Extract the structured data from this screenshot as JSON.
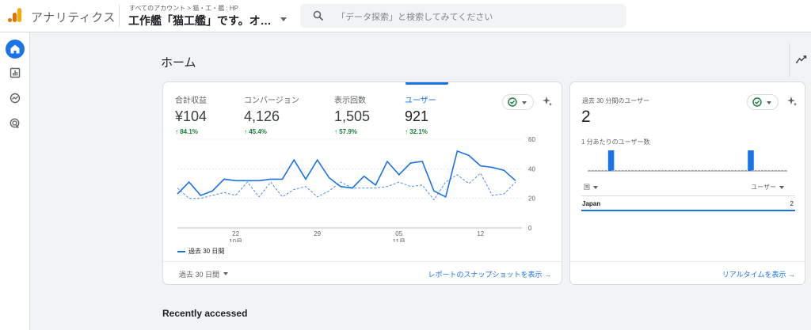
{
  "header": {
    "app_name": "アナリティクス",
    "breadcrumb": "すべてのアカウント > 猫・工・艦 : HP",
    "property": "工作艦「猫工艦」です。オ…",
    "search_placeholder": "「データ探索」と検索してみてください"
  },
  "leftnav": {
    "items": [
      {
        "name": "home",
        "icon": "home-icon",
        "active": true
      },
      {
        "name": "reports",
        "icon": "bar-chart-icon",
        "active": false
      },
      {
        "name": "explore",
        "icon": "explore-icon",
        "active": false
      },
      {
        "name": "advertising",
        "icon": "target-icon",
        "active": false
      }
    ]
  },
  "page": {
    "title": "ホーム",
    "recent_heading": "Recently accessed"
  },
  "overview": {
    "metrics": [
      {
        "label": "合計収益",
        "value": "¥104",
        "change": "84.1%",
        "selected": false
      },
      {
        "label": "コンバージョン",
        "value": "4,126",
        "change": "45.4%",
        "selected": false
      },
      {
        "label": "表示回数",
        "value": "1,505",
        "change": "57.9%",
        "selected": false
      },
      {
        "label": "ユーザー",
        "value": "921",
        "change": "32.1%",
        "selected": true
      }
    ],
    "legend": "過去 30 日間",
    "period_selector": "過去 30 日間",
    "snapshot_link": "レポートのスナップショットを表示 →"
  },
  "chart_data": {
    "type": "line",
    "x_tick_labels": [
      {
        "day": "22",
        "month": "10月"
      },
      {
        "day": "29",
        "month": ""
      },
      {
        "day": "05",
        "month": "11月"
      },
      {
        "day": "12",
        "month": ""
      }
    ],
    "y_ticks": [
      0,
      20,
      40,
      60
    ],
    "ylim": [
      0,
      60
    ],
    "series": [
      {
        "name": "過去 30 日間",
        "style": "solid",
        "color": "#1a73e8",
        "values": [
          23,
          31,
          22,
          25,
          33,
          32,
          32,
          32,
          33,
          33,
          46,
          33,
          46,
          34,
          28,
          27,
          35,
          29,
          45,
          36,
          44,
          45,
          25,
          21,
          52,
          49,
          42,
          41,
          39,
          32
        ]
      },
      {
        "name": "",
        "style": "dashed",
        "color": "#4a8ff0",
        "values": [
          27,
          20,
          20,
          22,
          24,
          22,
          31,
          21,
          31,
          21,
          26,
          28,
          21,
          25,
          31,
          27,
          27,
          27,
          28,
          31,
          28,
          29,
          19,
          31,
          36,
          30,
          37,
          22,
          23,
          31
        ]
      }
    ]
  },
  "realtime": {
    "title": "過去 30 分間のユーザー",
    "value": "2",
    "subtitle": "1 分あたりのユーザー数",
    "per_minute": [
      0,
      0,
      0,
      0,
      0,
      0,
      1,
      0,
      0,
      0,
      0,
      0,
      0,
      0,
      0,
      0,
      0,
      0,
      0,
      0,
      0,
      0,
      0,
      0,
      0,
      0,
      0,
      0,
      0,
      0,
      0,
      0,
      0,
      0,
      0,
      0,
      0,
      0,
      0,
      0,
      0,
      0,
      0,
      0,
      0,
      0,
      0,
      0,
      1,
      0,
      0,
      0,
      0,
      0,
      0,
      0,
      0,
      0,
      0,
      0
    ],
    "col_country": "国",
    "col_users": "ユーザー",
    "rows": [
      {
        "country": "Japan",
        "users": "2"
      }
    ],
    "link": "リアルタイムを表示 →"
  },
  "colors": {
    "accent": "#1a73e8",
    "positive": "#188038"
  }
}
